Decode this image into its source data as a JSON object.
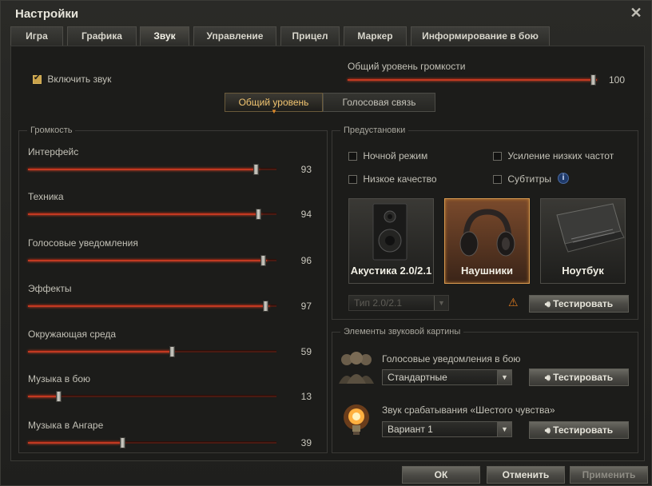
{
  "window": {
    "title": "Настройки"
  },
  "tabs": [
    {
      "label": "Игра"
    },
    {
      "label": "Графика"
    },
    {
      "label": "Звук"
    },
    {
      "label": "Управление"
    },
    {
      "label": "Прицел"
    },
    {
      "label": "Маркер"
    },
    {
      "label": "Информирование в бою"
    }
  ],
  "top": {
    "enable_sound_label": "Включить звук",
    "enable_sound": true,
    "master_label": "Общий уровень громкости",
    "master_value": "100",
    "master_level": 1.0
  },
  "subtabs": [
    {
      "label": "Общий уровень"
    },
    {
      "label": "Голосовая связь"
    }
  ],
  "volume": {
    "title": "Громкость",
    "sliders": [
      {
        "label": "Интерфейс",
        "value": "93",
        "level": 0.93
      },
      {
        "label": "Техника",
        "value": "94",
        "level": 0.94
      },
      {
        "label": "Голосовые уведомления",
        "value": "96",
        "level": 0.96
      },
      {
        "label": "Эффекты",
        "value": "97",
        "level": 0.97
      },
      {
        "label": "Окружающая среда",
        "value": "59",
        "level": 0.59
      },
      {
        "label": "Музыка в бою",
        "value": "13",
        "level": 0.13
      },
      {
        "label": "Музыка в Ангаре",
        "value": "39",
        "level": 0.39
      }
    ]
  },
  "presets": {
    "title": "Предустановки",
    "options": [
      {
        "label": "Ночной режим",
        "checked": false
      },
      {
        "label": "Усиление низких частот",
        "checked": false
      },
      {
        "label": "Низкое качество",
        "checked": false
      },
      {
        "label": "Субтитры",
        "checked": false
      }
    ],
    "devices": [
      {
        "label": "Акустика 2.0/2.1",
        "icon": "speaker-icon",
        "selected": false
      },
      {
        "label": "Наушники",
        "icon": "headphones-icon",
        "selected": true
      },
      {
        "label": "Ноутбук",
        "icon": "laptop-icon",
        "selected": false
      }
    ],
    "type_select": "Тип 2.0/2.1",
    "test_label": "Тестировать"
  },
  "elements": {
    "title": "Элементы звуковой картины",
    "voice_label": "Голосовые уведомления в бою",
    "voice_value": "Стандартные",
    "sixth_label": "Звук срабатывания «Шестого чувства»",
    "sixth_value": "Вариант 1",
    "test_label": "Тестировать"
  },
  "footer": {
    "ok": "ОК",
    "cancel": "Отменить",
    "apply": "Применить"
  }
}
